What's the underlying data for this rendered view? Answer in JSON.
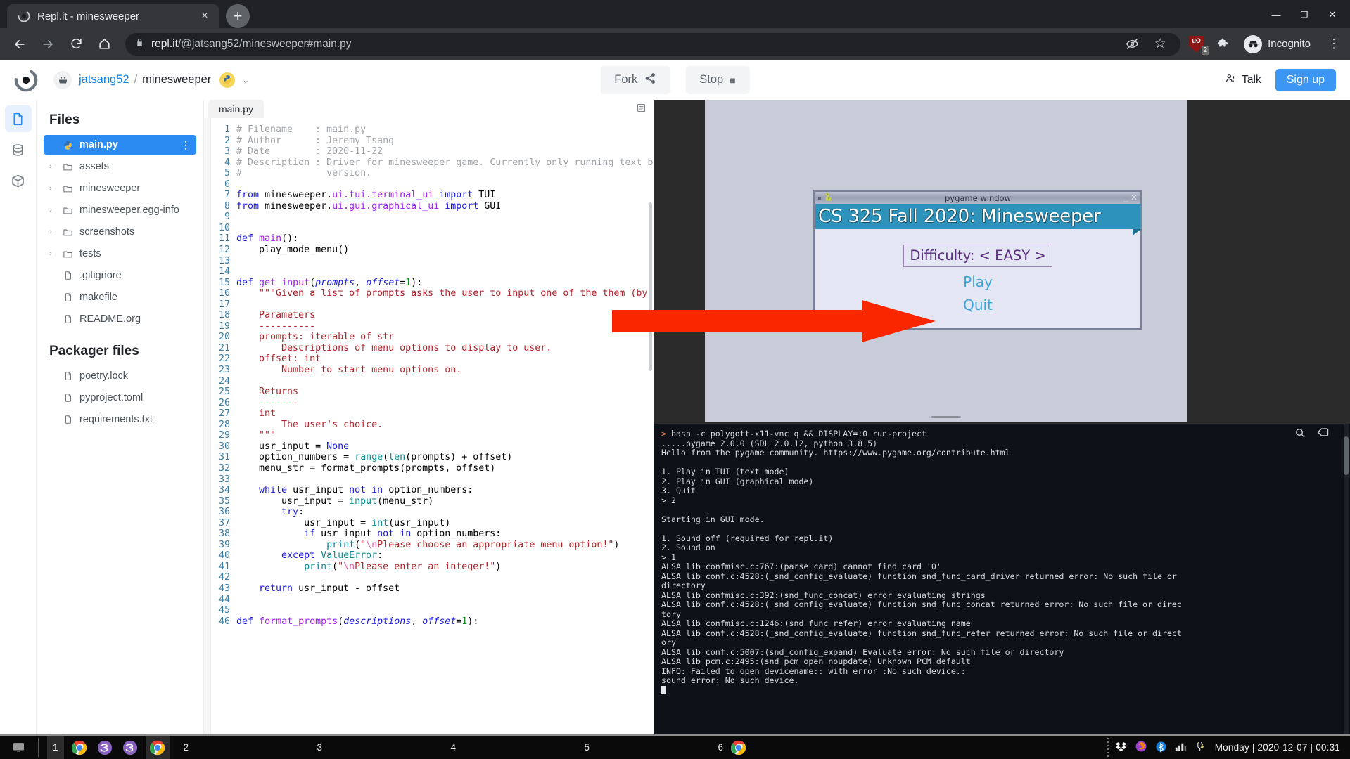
{
  "browser": {
    "tab": {
      "title": "Repl.it - minesweeper",
      "favicon": "replit-icon",
      "close": "×"
    },
    "new_tab_label": "+",
    "nav": {
      "back": "←",
      "forward": "→",
      "reload": "⟳",
      "home": "⌂"
    },
    "omnibox": {
      "lock": "lock-icon",
      "url_domain": "repl.it",
      "url_path": "/@jatsang52/minesweeper#main.py"
    },
    "toolbar_icons": {
      "eye_slash": "eye-slash-icon",
      "bookmark_star": "☆",
      "ublock_label": "uO",
      "ublock_badge": "2",
      "extensions": "puzzle-icon",
      "incognito_label": "Incognito",
      "menu": "⋮"
    },
    "window_controls": {
      "minimize": "—",
      "maximize": "❐",
      "close": "✕"
    }
  },
  "replit": {
    "header": {
      "logo": "replit-logo",
      "avatar": "user-avatar",
      "username": "jatsang52",
      "separator": "/",
      "repl_name": "minesweeper",
      "language_icon": "python-icon",
      "caret": "⌄",
      "fork_label": "Fork",
      "fork_icon": "share-icon",
      "stop_label": "Stop",
      "stop_icon": "■",
      "talk_label": "Talk",
      "talk_icon": "people-icon",
      "signup_label": "Sign up"
    },
    "rail": [
      {
        "name": "files-rail-icon",
        "icon": "file-icon",
        "active": true
      },
      {
        "name": "database-rail-icon",
        "icon": "database-icon",
        "active": false
      },
      {
        "name": "packages-rail-icon",
        "icon": "box-icon",
        "active": false
      }
    ],
    "sidebar": {
      "title": "Files",
      "packager_title": "Packager files",
      "files": [
        {
          "label": "main.py",
          "type": "file",
          "icon": "python-icon",
          "selected": true,
          "menu": "⋮"
        },
        {
          "label": "assets",
          "type": "folder",
          "icon": "folder-icon",
          "selected": false
        },
        {
          "label": "minesweeper",
          "type": "folder",
          "icon": "folder-icon",
          "selected": false
        },
        {
          "label": "minesweeper.egg-info",
          "type": "folder",
          "icon": "folder-icon",
          "selected": false
        },
        {
          "label": "screenshots",
          "type": "folder",
          "icon": "folder-icon",
          "selected": false
        },
        {
          "label": "tests",
          "type": "folder",
          "icon": "folder-icon",
          "selected": false
        },
        {
          "label": ".gitignore",
          "type": "file",
          "icon": "file-icon",
          "selected": false
        },
        {
          "label": "makefile",
          "type": "file",
          "icon": "file-icon",
          "selected": false
        },
        {
          "label": "README.org",
          "type": "file",
          "icon": "file-icon",
          "selected": false
        }
      ],
      "packager_files": [
        {
          "label": "poetry.lock",
          "type": "file",
          "icon": "file-icon"
        },
        {
          "label": "pyproject.toml",
          "type": "file",
          "icon": "file-icon"
        },
        {
          "label": "requirements.txt",
          "type": "file",
          "icon": "file-icon"
        }
      ]
    },
    "editor": {
      "tab_label": "main.py",
      "panel_icon": "editor-menu-icon",
      "first_line": 1,
      "lines": [
        {
          "n": 1,
          "t": "# Filename    : main.py",
          "k": "comment"
        },
        {
          "n": 2,
          "t": "# Author      : Jeremy Tsang",
          "k": "comment"
        },
        {
          "n": 3,
          "t": "# Date        : 2020-11-22",
          "k": "comment"
        },
        {
          "n": 4,
          "t": "# Description : Driver for minesweeper game. Currently only running text based",
          "k": "comment"
        },
        {
          "n": 5,
          "t": "#               version.",
          "k": "comment"
        },
        {
          "n": 6,
          "t": "",
          "k": "blank"
        },
        {
          "n": 7,
          "t": "from minesweeper.ui.tui.terminal_ui import TUI",
          "k": "import"
        },
        {
          "n": 8,
          "t": "from minesweeper.ui.gui.graphical_ui import GUI",
          "k": "import"
        },
        {
          "n": 9,
          "t": "",
          "k": "blank"
        },
        {
          "n": 10,
          "t": "",
          "k": "blank"
        },
        {
          "n": 11,
          "t": "def main():",
          "k": "def"
        },
        {
          "n": 12,
          "t": "    play_mode_menu()",
          "k": "code"
        },
        {
          "n": 13,
          "t": "",
          "k": "blank"
        },
        {
          "n": 14,
          "t": "",
          "k": "blank"
        },
        {
          "n": 15,
          "t": "def get_input(prompts, offset=1):",
          "k": "def"
        },
        {
          "n": 16,
          "t": "    \"\"\"Given a list of prompts asks the user to input one of the them (by index).",
          "k": "doc"
        },
        {
          "n": 17,
          "t": "",
          "k": "blank"
        },
        {
          "n": 18,
          "t": "    Parameters",
          "k": "doc"
        },
        {
          "n": 19,
          "t": "    ----------",
          "k": "doc"
        },
        {
          "n": 20,
          "t": "    prompts: iterable of str",
          "k": "doc"
        },
        {
          "n": 21,
          "t": "        Descriptions of menu options to display to user.",
          "k": "doc"
        },
        {
          "n": 22,
          "t": "    offset: int",
          "k": "doc"
        },
        {
          "n": 23,
          "t": "        Number to start menu options on.",
          "k": "doc"
        },
        {
          "n": 24,
          "t": "",
          "k": "blank"
        },
        {
          "n": 25,
          "t": "    Returns",
          "k": "doc"
        },
        {
          "n": 26,
          "t": "    -------",
          "k": "doc"
        },
        {
          "n": 27,
          "t": "    int",
          "k": "doc"
        },
        {
          "n": 28,
          "t": "        The user's choice.",
          "k": "doc"
        },
        {
          "n": 29,
          "t": "    \"\"\"",
          "k": "doc"
        },
        {
          "n": 30,
          "t": "    usr_input = None",
          "k": "code"
        },
        {
          "n": 31,
          "t": "    option_numbers = range(len(prompts) + offset)",
          "k": "code"
        },
        {
          "n": 32,
          "t": "    menu_str = format_prompts(prompts, offset)",
          "k": "code"
        },
        {
          "n": 33,
          "t": "",
          "k": "blank"
        },
        {
          "n": 34,
          "t": "    while usr_input not in option_numbers:",
          "k": "code"
        },
        {
          "n": 35,
          "t": "        usr_input = input(menu_str)",
          "k": "code"
        },
        {
          "n": 36,
          "t": "        try:",
          "k": "code"
        },
        {
          "n": 37,
          "t": "            usr_input = int(usr_input)",
          "k": "code"
        },
        {
          "n": 38,
          "t": "            if usr_input not in option_numbers:",
          "k": "code"
        },
        {
          "n": 39,
          "t": "                print(\"\\nPlease choose an appropriate menu option!\")",
          "k": "code"
        },
        {
          "n": 40,
          "t": "        except ValueError:",
          "k": "code"
        },
        {
          "n": 41,
          "t": "            print(\"\\nPlease enter an integer!\")",
          "k": "code"
        },
        {
          "n": 42,
          "t": "",
          "k": "blank"
        },
        {
          "n": 43,
          "t": "    return usr_input - offset",
          "k": "code"
        },
        {
          "n": 44,
          "t": "",
          "k": "blank"
        },
        {
          "n": 45,
          "t": "",
          "k": "blank"
        },
        {
          "n": 46,
          "t": "def format_prompts(descriptions, offset=1):",
          "k": "def"
        }
      ]
    },
    "pygame": {
      "window_title": "pygame window",
      "tray_icon": "pygame-icon",
      "minimize": "_",
      "close": "✕",
      "banner_title": "CS 325 Fall 2020: Minesweeper",
      "difficulty_label": "Difficulty: < EASY >",
      "menu": [
        "Play",
        "Quit"
      ]
    },
    "console": {
      "search_icon": "search-icon",
      "clear_icon": "clear-icon",
      "lines": [
        "bash -c polygott-x11-vnc q && DISPLAY=:0 run-project",
        ".....pygame 2.0.0 (SDL 2.0.12, python 3.8.5)",
        "Hello from the pygame community. https://www.pygame.org/contribute.html",
        "",
        "1. Play in TUI (text mode)",
        "2. Play in GUI (graphical mode)",
        "3. Quit",
        "> 2",
        "",
        "Starting in GUI mode.",
        "",
        "1. Sound off (required for repl.it)",
        "2. Sound on",
        "> 1",
        "ALSA lib confmisc.c:767:(parse_card) cannot find card '0'",
        "ALSA lib conf.c:4528:(_snd_config_evaluate) function snd_func_card_driver returned error: No such file or",
        "directory",
        "ALSA lib confmisc.c:392:(snd_func_concat) error evaluating strings",
        "ALSA lib conf.c:4528:(_snd_config_evaluate) function snd_func_concat returned error: No such file or direc",
        "tory",
        "ALSA lib confmisc.c:1246:(snd_func_refer) error evaluating name",
        "ALSA lib conf.c:4528:(_snd_config_evaluate) function snd_func_refer returned error: No such file or direct",
        "ory",
        "ALSA lib conf.c:5007:(snd_config_expand) Evaluate error: No such file or directory",
        "ALSA lib pcm.c:2495:(snd_pcm_open_noupdate) Unknown PCM default",
        "INFO: Failed to open devicename:: with error :No such device.:",
        "sound error: No such device."
      ]
    },
    "annotation": {
      "arrow": "red-arrow-annotation",
      "color": "#fa2600"
    }
  },
  "taskbar": {
    "show_desktop_icon": "monitor-icon",
    "desktops": [
      {
        "num": "1",
        "active": true,
        "apps": [
          "chrome-icon",
          "emacs-icon",
          "emacs-icon",
          "chrome-icon"
        ]
      },
      {
        "num": "2",
        "active": false,
        "apps": []
      },
      {
        "num": "3",
        "active": false,
        "apps": []
      },
      {
        "num": "4",
        "active": false,
        "apps": []
      },
      {
        "num": "5",
        "active": false,
        "apps": []
      },
      {
        "num": "6",
        "active": false,
        "apps": [
          "chrome-icon"
        ]
      }
    ],
    "tray_icons": [
      "dropbox-icon",
      "firefox-icon",
      "bluetooth-icon",
      "signal-bars-icon",
      "power-icon"
    ],
    "clock": "Monday | 2020-12-07 | 00:31"
  }
}
